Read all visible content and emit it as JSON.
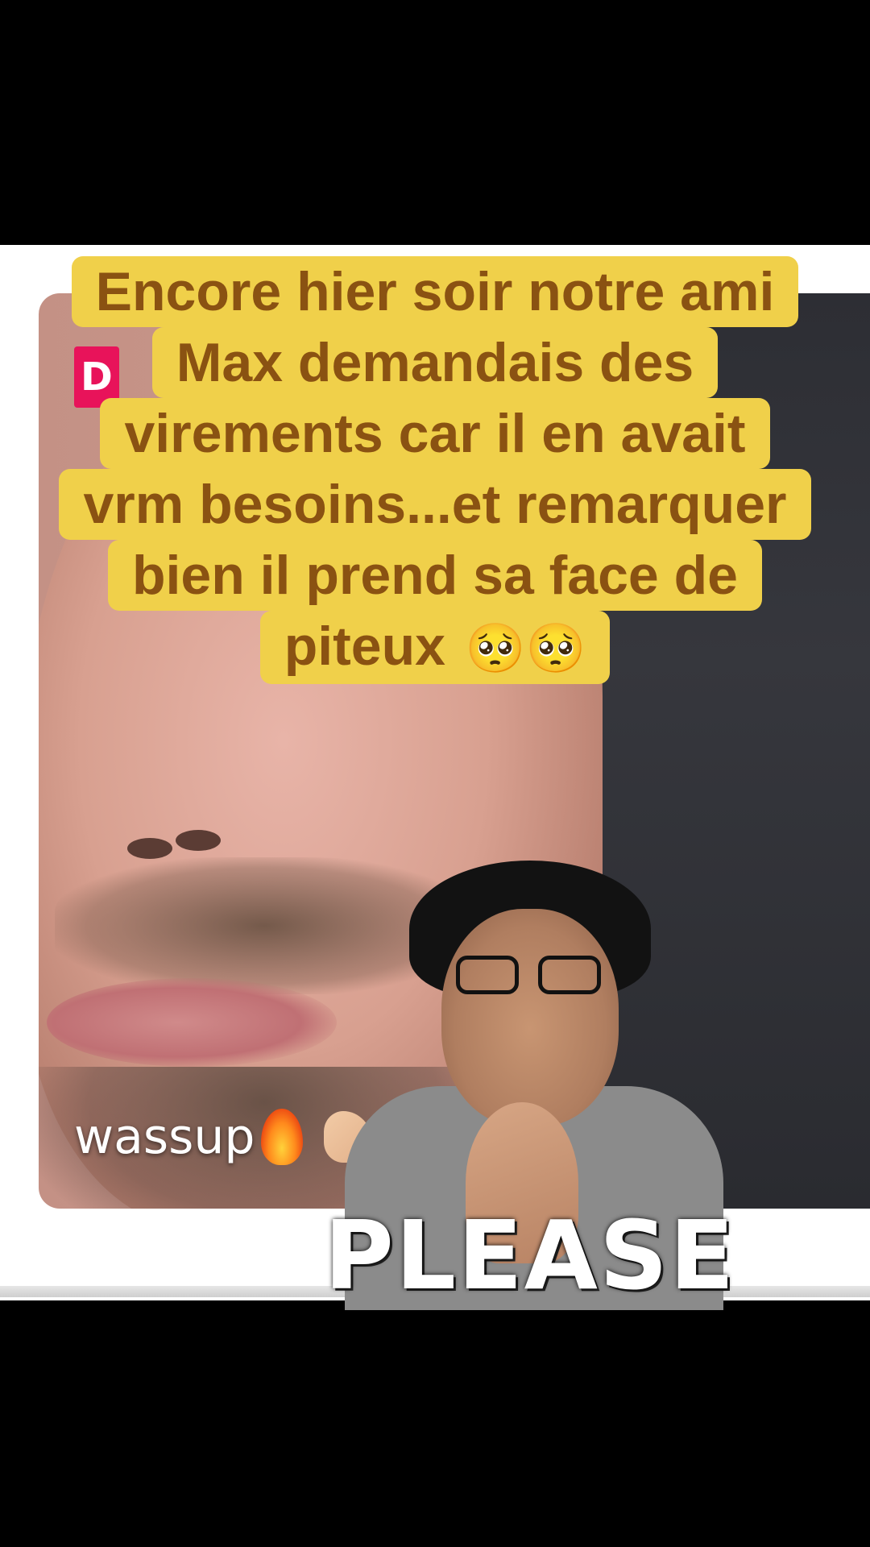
{
  "caption": {
    "lines": [
      "Encore hier soir notre ami",
      "Max demandais des",
      "virements car il en avait",
      "vrm besoins...et remarquer",
      "bien il prend sa face de",
      "piteux"
    ],
    "emoji_suffix": "🥺🥺"
  },
  "badge": {
    "letter": "D"
  },
  "video": {
    "overlay_text": "wassup"
  },
  "sticker": {
    "text": "PLEASE"
  },
  "icons": [
    "flame-icon",
    "flexed-arm-icon",
    "pleading-face-emoji"
  ],
  "colors": {
    "caption_bg": "#f0d04a",
    "caption_text": "#8a5212",
    "badge": "#e8135a",
    "background": "#000000"
  }
}
